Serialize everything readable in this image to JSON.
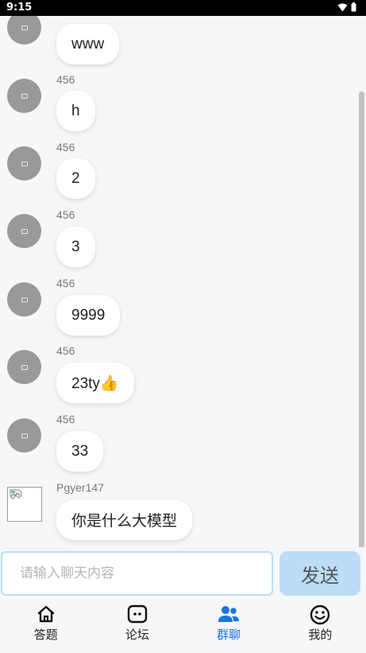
{
  "status_bar": {
    "time": "9:15"
  },
  "messages": [
    {
      "sender": "",
      "text": "www",
      "avatar": "default-avatar"
    },
    {
      "sender": "456",
      "text": "h",
      "avatar": "default-avatar"
    },
    {
      "sender": "456",
      "text": "2",
      "avatar": "default-avatar"
    },
    {
      "sender": "456",
      "text": "3",
      "avatar": "default-avatar"
    },
    {
      "sender": "456",
      "text": "9999",
      "avatar": "default-avatar"
    },
    {
      "sender": "456",
      "text": "23ty👍",
      "avatar": "default-avatar"
    },
    {
      "sender": "456",
      "text": "33",
      "avatar": "default-avatar"
    },
    {
      "sender": "Pgyer147",
      "text": "你是什么大模型",
      "avatar": "broken-image-icon"
    }
  ],
  "input": {
    "placeholder": "请输入聊天内容",
    "value": ""
  },
  "send_label": "发送",
  "tabs": [
    {
      "label": "答题",
      "icon": "home-icon",
      "active": false
    },
    {
      "label": "论坛",
      "icon": "forum-icon",
      "active": false
    },
    {
      "label": "群聊",
      "icon": "group-icon",
      "active": true
    },
    {
      "label": "我的",
      "icon": "smile-icon",
      "active": false
    }
  ],
  "colors": {
    "accent": "#1a73e8",
    "send_bg": "#bcdcf7",
    "input_border": "#b9dff4"
  }
}
